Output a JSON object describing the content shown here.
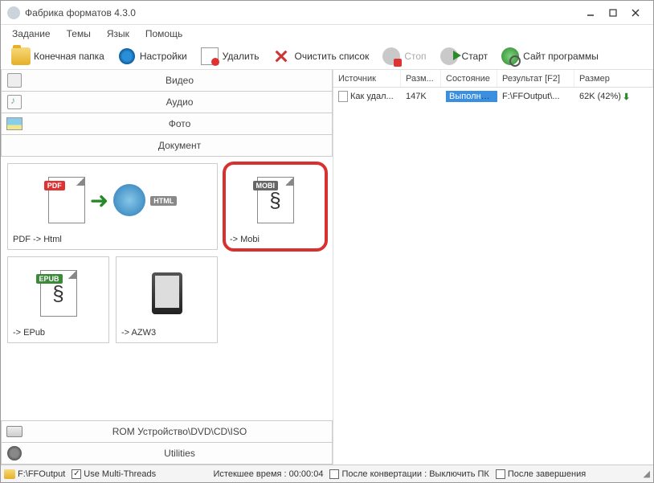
{
  "window": {
    "title": "Фабрика форматов 4.3.0"
  },
  "menubar": {
    "items": [
      "Задание",
      "Темы",
      "Язык",
      "Помощь"
    ]
  },
  "toolbar": {
    "output_folder": "Конечная папка",
    "settings": "Настройки",
    "delete": "Удалить",
    "clear_list": "Очистить список",
    "stop": "Стоп",
    "start": "Старт",
    "site": "Сайт программы"
  },
  "categories": {
    "video": "Видео",
    "audio": "Аудио",
    "photo": "Фото",
    "document": "Документ",
    "rom": "ROM Устройство\\DVD\\CD\\ISO",
    "utilities": "Utilities"
  },
  "doc_tiles": {
    "pdf_html": "PDF -> Html",
    "mobi": "-> Mobi",
    "epub": "-> EPub",
    "azw3": "-> AZW3"
  },
  "table": {
    "headers": {
      "source": "Источник",
      "size": "Разм...",
      "state": "Состояние",
      "result": "Результат [F2]",
      "outsize": "Размер"
    },
    "rows": [
      {
        "source": "Как удал...",
        "size": "147K",
        "state": "Выполнено",
        "result": "F:\\FFOutput\\...",
        "outsize": "62K (42%)"
      }
    ]
  },
  "statusbar": {
    "output_path": "F:\\FFOutput",
    "multi_threads": "Use Multi-Threads",
    "elapsed": "Истекшее время : 00:00:04",
    "after_convert": "После конвертации : Выключить ПК",
    "after_finish": "После завершения"
  }
}
